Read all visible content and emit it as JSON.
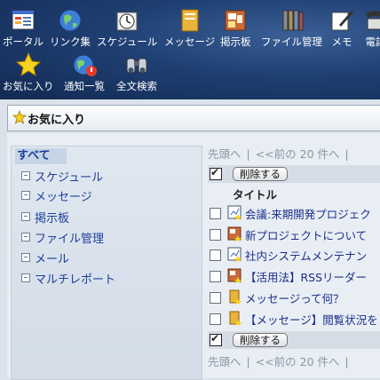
{
  "toolbar": {
    "items": [
      {
        "label": "ポータル",
        "icon": "portal-icon"
      },
      {
        "label": "リンク集",
        "icon": "globe-icon"
      },
      {
        "label": "スケジュール",
        "icon": "clock-icon"
      },
      {
        "label": "メッセージ",
        "icon": "message-icon"
      },
      {
        "label": "掲示板",
        "icon": "bulletin-board-icon"
      },
      {
        "label": "ファイル管理",
        "icon": "file-cabinet-icon"
      },
      {
        "label": "メモ",
        "icon": "memo-icon"
      },
      {
        "label": "電話",
        "icon": "phone-icon"
      },
      {
        "label": "お気に入り",
        "icon": "star-icon"
      },
      {
        "label": "通知一覧",
        "icon": "notification-globe-icon"
      },
      {
        "label": "全文検索",
        "icon": "binoculars-icon"
      }
    ]
  },
  "favorites": {
    "title": "お気に入り",
    "categories": {
      "all": "すべて",
      "items": [
        "スケジュール",
        "メッセージ",
        "掲示板",
        "ファイル管理",
        "メール",
        "マルチレポート"
      ]
    },
    "pager": {
      "first": "先頭へ",
      "prev": "<<前の 20 件へ",
      "sep": "|"
    },
    "delete_label": "削除する",
    "column_title": "タイトル",
    "rows": [
      {
        "title": "会議:来期開発プロジェク",
        "icon": "schedule-icon",
        "checked": false
      },
      {
        "title": "新プロジェクトについて",
        "icon": "bulletin-icon",
        "checked": false
      },
      {
        "title": "社内システムメンテナン",
        "icon": "schedule-icon",
        "checked": false
      },
      {
        "title": "【活用法】RSSリーダー",
        "icon": "bulletin-icon",
        "checked": false
      },
      {
        "title": "メッセージって何？",
        "icon": "message-icon",
        "checked": false
      },
      {
        "title": "【メッセージ】閲覧状況を",
        "icon": "message-icon",
        "checked": false
      }
    ]
  },
  "colors": {
    "toolbar_bg": "#1f3f72",
    "link": "#1d3f99",
    "selected_bg": "#c7d4e6"
  }
}
